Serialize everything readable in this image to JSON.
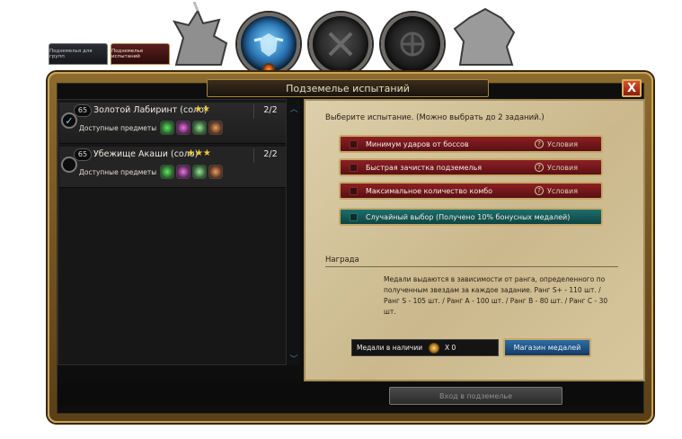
{
  "window": {
    "title": "Подземелье испытаний",
    "close_label": "X"
  },
  "tabs": [
    {
      "label": "Подземелья для групп",
      "active": false
    },
    {
      "label": "Подземелье испытаний",
      "active": true
    }
  ],
  "dungeons": [
    {
      "level": "65",
      "name": "Золотой Лабиринт (соло)",
      "stars": "★★",
      "count": "2/2",
      "available_label": "Доступные предметы",
      "selected": true,
      "items": [
        "green-item-icon",
        "purple-item-icon",
        "mint-item-icon",
        "orange-item-icon"
      ]
    },
    {
      "level": "65",
      "name": "Убежище Акаши (соло)",
      "stars": "★★★",
      "count": "2/2",
      "available_label": "Доступные предметы",
      "selected": false,
      "items": [
        "green-item-icon",
        "purple-item-icon",
        "mint-item-icon",
        "orange-item-icon"
      ]
    }
  ],
  "challenges": {
    "instruction": "Выберите испытание. (Можно выбрать до 2 заданий.)",
    "options": [
      {
        "label": "Минимум ударов от боссов",
        "condition": "Условия",
        "color": "#8c2024"
      },
      {
        "label": "Быстрая зачистка подземелья",
        "condition": "Условия",
        "color": "#8c2024"
      },
      {
        "label": "Максимальное количество комбо",
        "condition": "Условия",
        "color": "#8c2024"
      }
    ],
    "random": {
      "label": "Случайный выбор (Получено 10% бонусных медалей)",
      "color": "#1d6e6c"
    }
  },
  "reward": {
    "header": "Награда",
    "text": "Медали выдаются в зависимости от ранга, определенного по полученным звездам за каждое задание. Ранг S+ - 110 шт. / Ранг S - 105 шт. / Ранг A - 100 шт. / Ранг B - 80 шт. / Ранг C - 30 шт.",
    "medals_label": "Медали в наличии",
    "medals_value": "X 0",
    "shop_button": "Магазин медалей"
  },
  "enter_button": "Вход в подземелье"
}
